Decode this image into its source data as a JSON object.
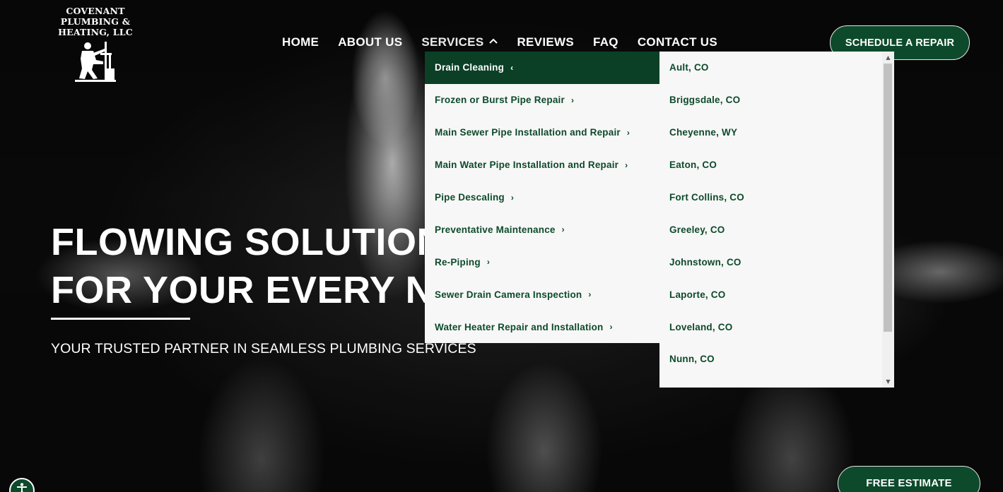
{
  "logo": {
    "line1": "COVENANT",
    "line2": "PLUMBING &",
    "line3": "HEATING, LLC",
    "icon": "plumber-figure-icon"
  },
  "nav": {
    "items": [
      {
        "label": "HOME"
      },
      {
        "label": "ABOUT US"
      },
      {
        "label": "SERVICES",
        "icon": "chevron-up-icon",
        "expanded": true
      },
      {
        "label": "REVIEWS"
      },
      {
        "label": "FAQ"
      },
      {
        "label": "CONTACT US"
      }
    ]
  },
  "header": {
    "cta_label": "SCHEDULE A REPAIR"
  },
  "hero": {
    "title_line1": "FLOWING SOLUTIONS",
    "title_line2": "FOR YOUR EVERY NEED",
    "subtitle": "YOUR TRUSTED PARTNER IN SEAMLESS PLUMBING SERVICES"
  },
  "services_menu": {
    "items": [
      {
        "label": "Drain Cleaning",
        "selected": true
      },
      {
        "label": "Frozen or Burst Pipe Repair"
      },
      {
        "label": "Main Sewer Pipe Installation and Repair"
      },
      {
        "label": "Main Water Pipe Installation and Repair"
      },
      {
        "label": "Pipe Descaling"
      },
      {
        "label": "Preventative Maintenance"
      },
      {
        "label": "Re-Piping"
      },
      {
        "label": "Sewer Drain Camera Inspection"
      },
      {
        "label": "Water Heater Repair and Installation"
      }
    ]
  },
  "locations_menu": {
    "items": [
      {
        "label": "Ault, CO"
      },
      {
        "label": "Briggsdale, CO"
      },
      {
        "label": "Cheyenne, WY"
      },
      {
        "label": "Eaton, CO"
      },
      {
        "label": "Fort Collins, CO"
      },
      {
        "label": "Greeley, CO"
      },
      {
        "label": "Johnstown, CO"
      },
      {
        "label": "Laporte, CO"
      },
      {
        "label": "Loveland, CO"
      },
      {
        "label": "Nunn, CO"
      }
    ]
  },
  "footer_cta": {
    "label": "FREE ESTIMATE"
  },
  "accessibility": {
    "icon": "accessibility-icon"
  },
  "colors": {
    "brand_green": "#0d4a2b",
    "menu_bg": "#f7f7f7",
    "selected_bg": "#0b4026"
  }
}
